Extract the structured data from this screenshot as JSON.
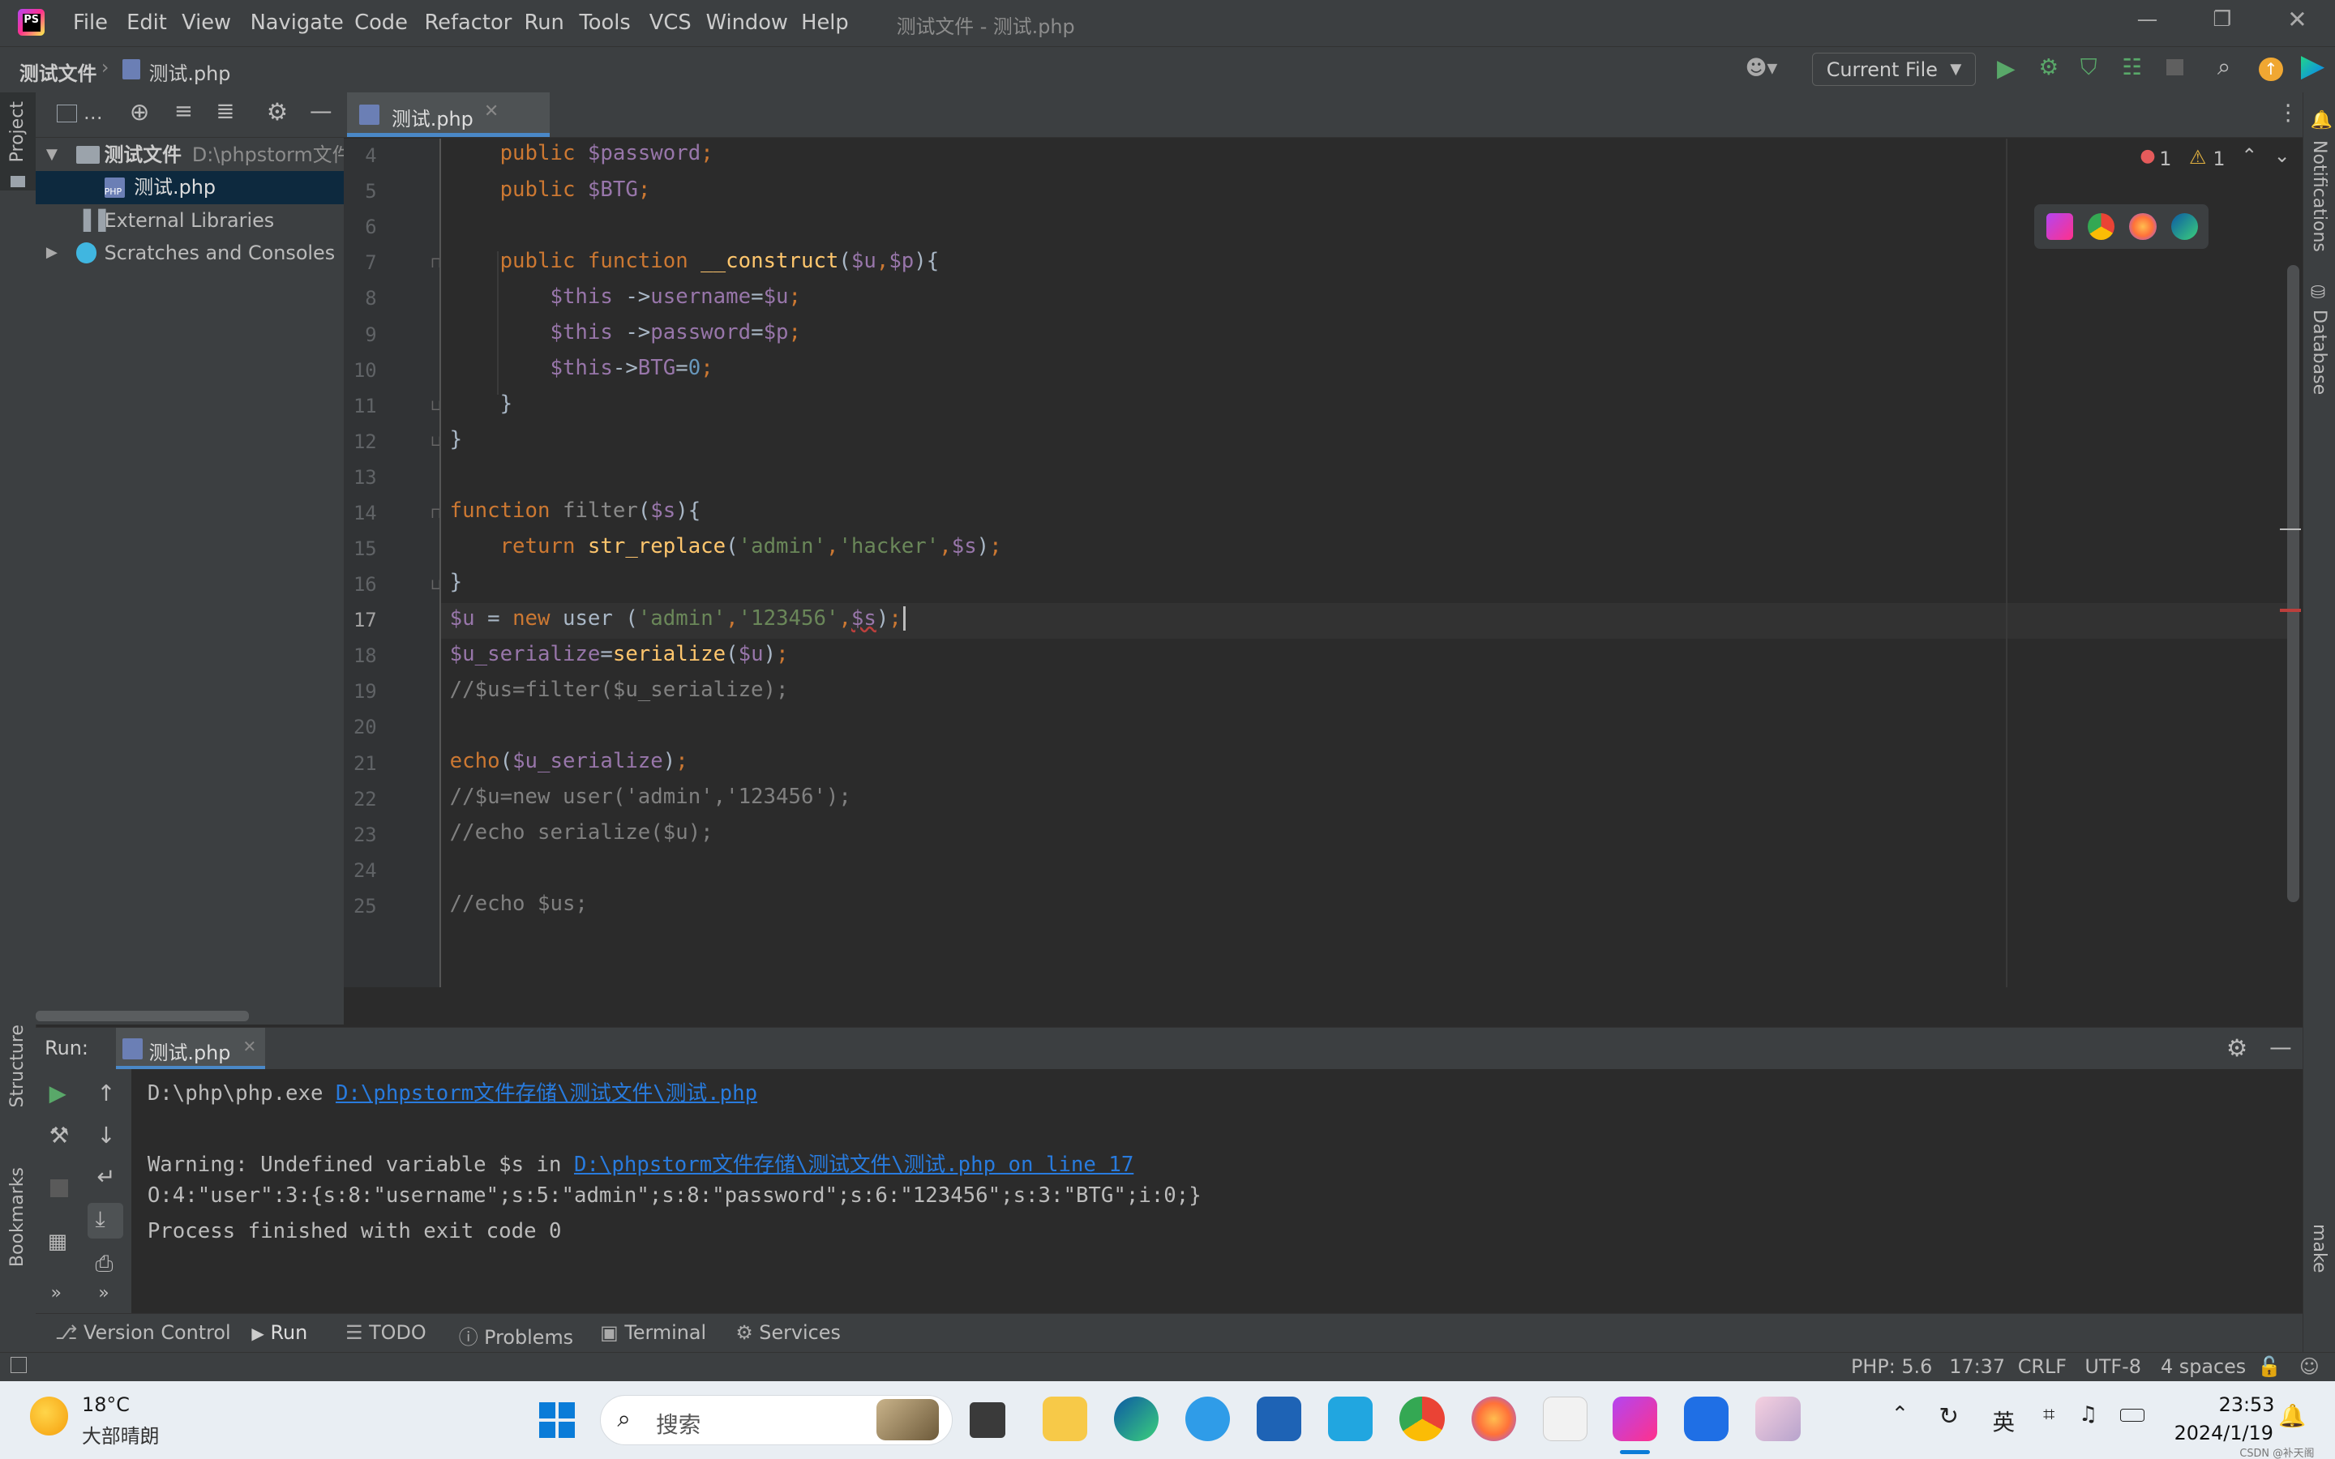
{
  "menu": {
    "items": [
      "File",
      "Edit",
      "View",
      "Navigate",
      "Code",
      "Refactor",
      "Run",
      "Tools",
      "VCS",
      "Window",
      "Help"
    ],
    "window_title": "测试文件 - 测试.php"
  },
  "navbar": {
    "breadcrumb_project": "测试文件",
    "breadcrumb_file": "测试.php",
    "run_config": "Current File"
  },
  "left_strip": {
    "project": "Project",
    "structure": "Structure",
    "bookmarks": "Bookmarks"
  },
  "right_strip": {
    "notifications": "Notifications",
    "database": "Database",
    "make": "make"
  },
  "project_tree": {
    "root_name": "测试文件",
    "root_path": "D:\\phpstorm文件",
    "file": "测试.php",
    "external": "External Libraries",
    "scratches": "Scratches and Consoles"
  },
  "editor": {
    "tab_label": "测试.php",
    "errors": "1",
    "warnings": "1",
    "line_numbers": [
      "4",
      "5",
      "6",
      "7",
      "8",
      "9",
      "10",
      "11",
      "12",
      "13",
      "14",
      "15",
      "16",
      "17",
      "18",
      "19",
      "20",
      "21",
      "22",
      "23",
      "24",
      "25"
    ],
    "current_line": "17"
  },
  "run": {
    "label": "Run:",
    "tab": "测试.php",
    "line1_prefix": "D:\\php\\php.exe ",
    "line1_link": "D:\\phpstorm文件存储\\测试文件\\测试.php",
    "line2_prefix": "Warning: Undefined variable $s in ",
    "line2_link": "D:\\phpstorm文件存储\\测试文件\\测试.php on line 17",
    "line3": "O:4:\"user\":3:{s:8:\"username\";s:5:\"admin\";s:8:\"password\";s:6:\"123456\";s:3:\"BTG\";i:0;}",
    "line4": "Process finished with exit code 0"
  },
  "tool_windows": [
    "Version Control",
    "Run",
    "TODO",
    "Problems",
    "Terminal",
    "Services"
  ],
  "status": {
    "php": "PHP: 5.6",
    "position": "17:37",
    "line_sep": "CRLF",
    "encoding": "UTF-8",
    "indent": "4 spaces"
  },
  "taskbar": {
    "temperature": "18°C",
    "weather": "大部晴朗",
    "search_placeholder": "搜索",
    "lang": "英",
    "time": "23:53",
    "date": "2024/1/19",
    "watermark": "CSDN @补天阁"
  }
}
